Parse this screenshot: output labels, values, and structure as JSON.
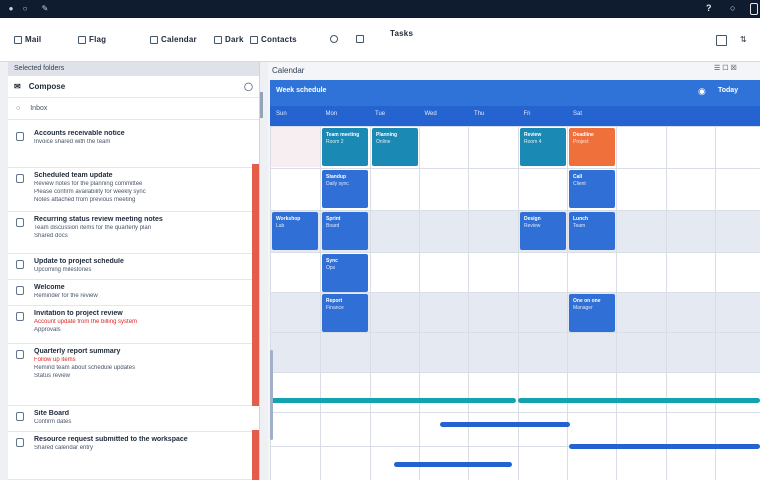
{
  "titlebar": {
    "right_help": "?",
    "right_icon": "notification-icon"
  },
  "toolbar": {
    "items": [
      {
        "icon": "mail-icon",
        "label": "Mail"
      },
      {
        "icon": "flag-icon",
        "label": "Flag"
      },
      {
        "icon": "folder-icon",
        "label": "Calendar"
      },
      {
        "icon": "grid-icon",
        "label": "Dark"
      },
      {
        "icon": "people-icon",
        "label": "Contacts"
      }
    ],
    "right_label": "Tasks"
  },
  "left": {
    "header": "Selected folders",
    "compose_label": "Compose",
    "search_label": "Inbox",
    "mails": [
      {
        "from": "Accounts receivable notice",
        "lines": [
          "Invoice shared with the team"
        ]
      },
      {
        "from": "Scheduled team update",
        "lines": [
          "Review notes for the planning committee",
          "Please confirm availability for weekly sync",
          "Notes attached from previous meeting"
        ]
      },
      {
        "from": "Recurring status review meeting notes",
        "lines": [
          "Team discussion items for the quarterly plan",
          "Shared docs"
        ]
      },
      {
        "from": "Update to project schedule",
        "lines": [
          "Upcoming milestones"
        ]
      },
      {
        "from": "Welcome",
        "lines": [
          "Reminder for the review"
        ]
      },
      {
        "from": "Invitation to project review",
        "lines": [
          "Account update from the billing system",
          "Approvals"
        ]
      },
      {
        "from": "Quarterly report summary",
        "lines": [
          "Follow up items",
          "Remind team about schedule updates",
          "Status review"
        ]
      },
      {
        "from": "Site Board",
        "lines": [
          "Confirm dates"
        ]
      },
      {
        "from": "Resource request submitted to the workspace",
        "lines": [
          "Shared calendar entry"
        ]
      }
    ]
  },
  "calendar": {
    "top_label": "Calendar",
    "header_title": "Week schedule",
    "header_right": "Today",
    "day_names": [
      "Sun",
      "Mon",
      "Tue",
      "Wed",
      "Thu",
      "Fri",
      "Sat"
    ],
    "events": [
      {
        "col": 1,
        "row": 0,
        "color": "teal",
        "title": "Team meeting",
        "sub": "Room 2"
      },
      {
        "col": 2,
        "row": 0,
        "color": "teal",
        "title": "Planning",
        "sub": "Online"
      },
      {
        "col": 5,
        "row": 0,
        "color": "teal",
        "title": "Review",
        "sub": "Room 4"
      },
      {
        "col": 6,
        "row": 0,
        "color": "orange",
        "title": "Deadline",
        "sub": "Project"
      },
      {
        "col": 1,
        "row": 1,
        "color": "blue",
        "title": "Standup",
        "sub": "Daily sync"
      },
      {
        "col": 6,
        "row": 1,
        "color": "blue",
        "title": "Call",
        "sub": "Client"
      },
      {
        "col": 0,
        "row": 2,
        "color": "blue",
        "title": "Workshop",
        "sub": "Lab"
      },
      {
        "col": 1,
        "row": 2,
        "color": "blue",
        "title": "Sprint",
        "sub": "Board"
      },
      {
        "col": 5,
        "row": 2,
        "color": "blue",
        "title": "Design",
        "sub": "Review"
      },
      {
        "col": 6,
        "row": 2,
        "color": "blue",
        "title": "Lunch",
        "sub": "Team"
      },
      {
        "col": 1,
        "row": 3,
        "color": "blue",
        "title": "Sync",
        "sub": "Ops"
      },
      {
        "col": 1,
        "row": 4,
        "color": "blue",
        "title": "Report",
        "sub": "Finance"
      },
      {
        "col": 6,
        "row": 4,
        "color": "blue",
        "title": "One on one",
        "sub": "Manager"
      }
    ]
  }
}
